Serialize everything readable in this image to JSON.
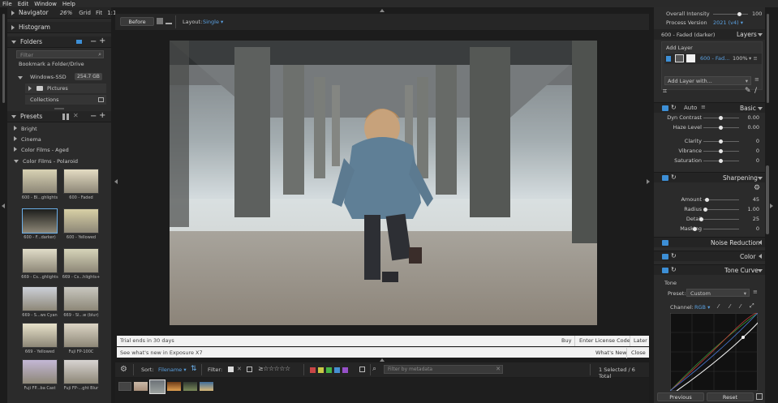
{
  "menu": [
    "File",
    "Edit",
    "Window",
    "Help"
  ],
  "navigator": {
    "title": "Navigator",
    "zoom": "26%",
    "grid": "Grid",
    "fit": "Fit",
    "one": "1:1"
  },
  "histogram": {
    "title": "Histogram"
  },
  "folders": {
    "title": "Folders",
    "filter_placeholder": "Filter",
    "bookmark": "Bookmark a Folder/Drive",
    "drive": "Windows-SSD",
    "drive_size": "254.7 GB",
    "pictures": "Pictures",
    "collections": "Collections"
  },
  "presets": {
    "title": "Presets",
    "categories": [
      "Bright",
      "Cinema",
      "Color Films - Aged",
      "Color Films - Polaroid"
    ],
    "thumbs": [
      [
        "600 - Bl...ghlights",
        "600 - Faded"
      ],
      [
        "600 - F...darker)",
        "600 - Yellowed"
      ],
      [
        "669 - Cs...ghlights",
        "669 - Cs...hlights+"
      ],
      [
        "669 - S...ws Cyan",
        "669 - Sl...w (blur)"
      ],
      [
        "669 - Yellowed",
        "Fuji FP-100C"
      ],
      [
        "Fuji FP...ba Cast",
        "Fuji FP-...ght Blur"
      ]
    ]
  },
  "center": {
    "before": "Before",
    "layout_label": "Layout:",
    "layout_value": "Single",
    "trial": "Trial ends in 30 days",
    "buy": "Buy",
    "enter_license": "Enter License Code",
    "later": "Later",
    "whats_new_text": "See what's new in Exposure X7",
    "whats_new": "What's New",
    "close": "Close"
  },
  "bottom": {
    "sort_label": "Sort:",
    "sort_value": "Filename",
    "filter_label": "Filter:",
    "metadata_placeholder": "Filter by metadata",
    "selection": "1 Selected / 6 Total",
    "label_colors": [
      "#c84646",
      "#c8c846",
      "#46b446",
      "#4690d2",
      "#9650c8"
    ]
  },
  "right": {
    "overall_intensity": "Overall Intensity",
    "overall_value": "100",
    "process_version": "Process Version",
    "process_value": "2021 (v4)",
    "preset_name": "600 - Faded (darker)",
    "layers": "Layers",
    "add_layer": "Add Layer",
    "layer_name": "600 - Fad...",
    "layer_pct": "100%",
    "add_layer_with": "Add Layer with...",
    "basic": {
      "auto": "Auto",
      "title": "Basic",
      "rows": [
        [
          "Dyn Contrast",
          "0.00"
        ],
        [
          "Haze Level",
          "0.00"
        ],
        [
          "Clarity",
          "0"
        ],
        [
          "Vibrance",
          "0"
        ],
        [
          "Saturation",
          "0"
        ]
      ]
    },
    "sharpening": {
      "title": "Sharpening",
      "rows": [
        [
          "Amount",
          "45"
        ],
        [
          "Radius",
          "1.00"
        ],
        [
          "Detail",
          "25"
        ],
        [
          "Masking",
          "0"
        ]
      ]
    },
    "noise": "Noise Reduction",
    "color": "Color",
    "tone_curve": "Tone Curve",
    "tone": "Tone",
    "preset_label": "Preset:",
    "preset_value": "Custom",
    "channel_label": "Channel:",
    "channel_value": "RGB",
    "previous": "Previous",
    "reset": "Reset"
  }
}
